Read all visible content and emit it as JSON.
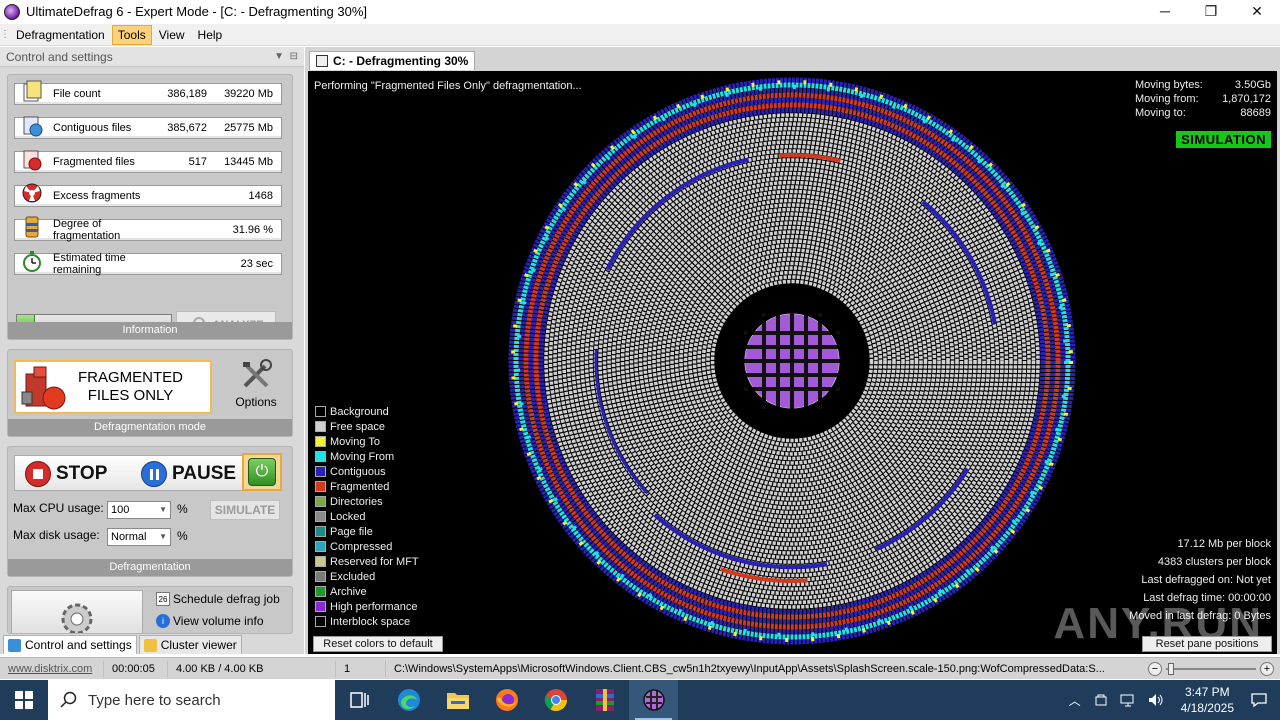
{
  "window": {
    "title": "UltimateDefrag 6 - Expert Mode - [C: - Defragmenting 30%]",
    "minimize": "─",
    "maximize": "❐",
    "close": "✕"
  },
  "menu": [
    "Defragmentation",
    "Tools",
    "View",
    "Help"
  ],
  "left_pane": {
    "header": "Control and settings",
    "stats": [
      {
        "label": "File count",
        "value1": "386,189",
        "value2": "39220 Mb"
      },
      {
        "label": "Contiguous files",
        "value1": "385,672",
        "value2": "25775 Mb"
      },
      {
        "label": "Fragmented files",
        "value1": "517",
        "value2": "13445 Mb"
      },
      {
        "label": "Excess fragments",
        "value1": "",
        "value2": "1468"
      },
      {
        "label": "Degree of fragmentation",
        "value1": "",
        "value2": "31.96 %"
      },
      {
        "label": "Estimated time remaining",
        "value1": "",
        "value2": "23 sec"
      }
    ],
    "progress_fraction": 0.12,
    "analyze_label": "ANALYZE",
    "information_label": "Information",
    "mode_line1": "FRAGMENTED",
    "mode_line2": "FILES ONLY",
    "options_label": "Options",
    "mode_footer": "Defragmentation mode",
    "stop_label": "STOP",
    "pause_label": "PAUSE",
    "cpu_label": "Max CPU usage:",
    "cpu_value": "100",
    "disk_label": "Max disk usage:",
    "disk_value": "Normal",
    "percent": "%",
    "simulate_label": "SIMULATE",
    "defrag_footer": "Defragmentation",
    "schedule_label": "Schedule defrag job",
    "volume_info_label": "View volume info",
    "tabs": [
      "Control and settings",
      "Cluster viewer"
    ]
  },
  "document_tab": "C: - Defragmenting 30%",
  "view": {
    "status_line": "Performing \"Fragmented Files Only\" defragmentation...",
    "moving": [
      {
        "label": "Moving bytes:",
        "value": "3.50Gb"
      },
      {
        "label": "Moving from:",
        "value": "1,870,172"
      },
      {
        "label": "Moving to:",
        "value": "88689"
      }
    ],
    "simulation_badge": "SIMULATION",
    "legend": [
      {
        "label": "Background",
        "color": "#000000"
      },
      {
        "label": "Free space",
        "color": "#d0d0d0"
      },
      {
        "label": "Moving To",
        "color": "#f2f23a"
      },
      {
        "label": "Moving From",
        "color": "#21e0e8"
      },
      {
        "label": "Contiguous",
        "color": "#2a22b8"
      },
      {
        "label": "Fragmented",
        "color": "#d23a1e"
      },
      {
        "label": "Directories",
        "color": "#7aa84a"
      },
      {
        "label": "Locked",
        "color": "#8a8a8a"
      },
      {
        "label": "Page file",
        "color": "#1e8a8a"
      },
      {
        "label": "Compressed",
        "color": "#2aa6b8"
      },
      {
        "label": "Reserved for MFT",
        "color": "#c8c890"
      },
      {
        "label": "Excluded",
        "color": "#7a7a7a"
      },
      {
        "label": "Archive",
        "color": "#1e9a2a"
      },
      {
        "label": "High performance",
        "color": "#8a2ad2"
      },
      {
        "label": "Interblock space",
        "color": "#000000"
      }
    ],
    "block_stats": [
      "17.12 Mb per block",
      "4383 clusters per block",
      "Last defragged on: Not yet",
      "Last defrag time: 00:00:00",
      "Moved in last defrag: 0 Bytes"
    ],
    "reset_colors": "Reset colors to default",
    "reset_pane": "Reset pane positions",
    "watermark": "ANY.RUN"
  },
  "statusbar": {
    "link": "www.disktrix.com",
    "time": "00:00:05",
    "size": "4.00 KB / 4.00 KB",
    "count": "1",
    "path": "C:\\Windows\\SystemApps\\MicrosoftWindows.Client.CBS_cw5n1h2txyewy\\InputApp\\Assets\\SplashScreen.scale-150.png:WofCompressedData:S..."
  },
  "taskbar": {
    "search_placeholder": "Type here to search",
    "time": "3:47 PM",
    "date": "4/18/2025",
    "icons": [
      "task-view-icon",
      "edge-icon",
      "file-explorer-icon",
      "firefox-icon",
      "chrome-icon",
      "winrar-icon",
      "ultimatedefrag-icon"
    ]
  }
}
